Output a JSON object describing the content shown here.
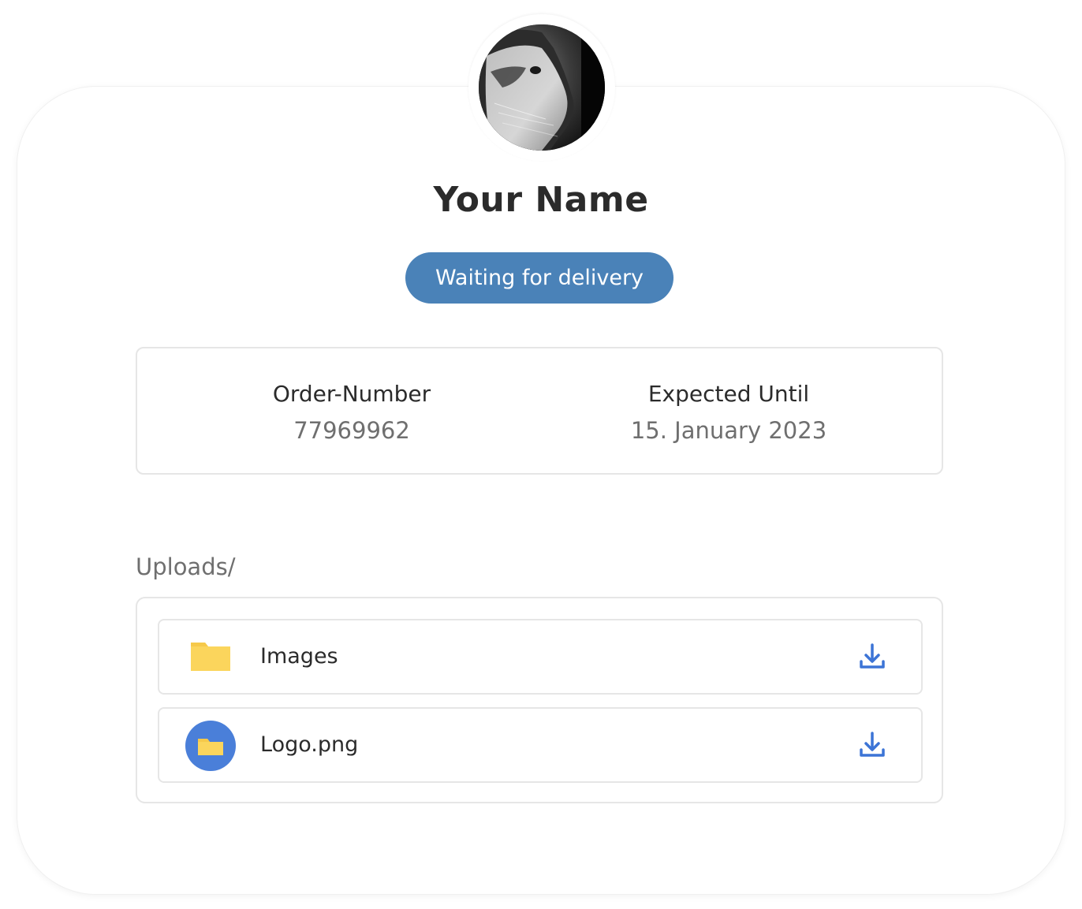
{
  "profile": {
    "name": "Your Name",
    "status": "Waiting for delivery"
  },
  "order": {
    "number_label": "Order-Number",
    "number_value": "77969962",
    "expected_label": "Expected Until",
    "expected_value": "15. January 2023"
  },
  "uploads": {
    "title": "Uploads/",
    "items": [
      {
        "name": "Images",
        "icon": "folder-icon"
      },
      {
        "name": "Logo.png",
        "icon": "file-icon"
      }
    ]
  },
  "colors": {
    "status_bg": "#4a82b8",
    "folder": "#fbd55c",
    "file_icon_bg": "#4a7fd9",
    "download": "#3c74d6"
  }
}
